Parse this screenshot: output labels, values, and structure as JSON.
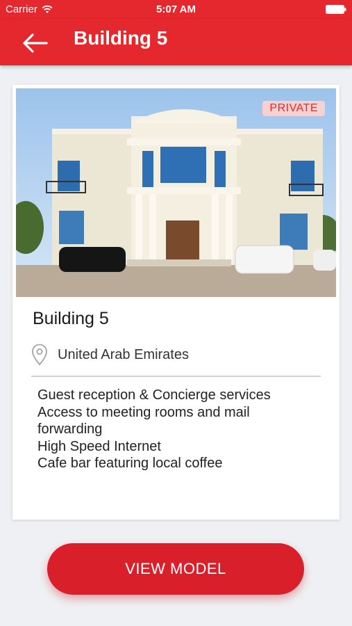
{
  "status_bar": {
    "carrier": "Carrier",
    "time": "5:07 AM"
  },
  "header": {
    "title": "Building 5",
    "back_icon": "arrow-left-icon"
  },
  "card": {
    "badge": "PRIVATE",
    "title": "Building 5",
    "location": "United Arab Emirates",
    "location_icon": "map-pin-icon",
    "features": [
      "Guest reception & Concierge services",
      "Access to meeting rooms and mail forwarding",
      "High Speed Internet",
      "Cafe bar featuring local coffee"
    ]
  },
  "cta": {
    "label": "VIEW MODEL"
  },
  "colors": {
    "brand_red": "#e5282e",
    "badge_bg": "#f7d1cf",
    "background": "#eef0f3"
  }
}
